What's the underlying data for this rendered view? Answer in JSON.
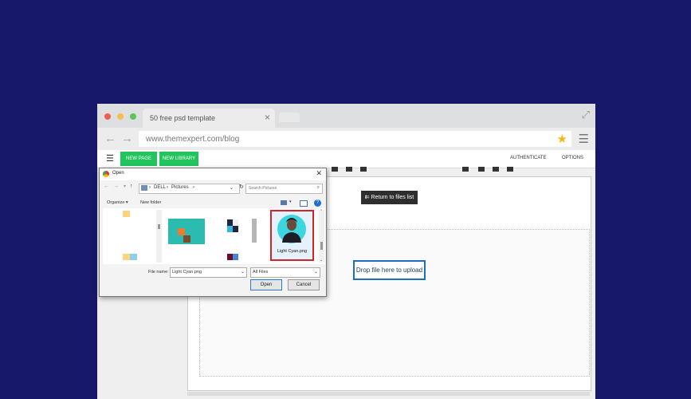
{
  "browser": {
    "tab_title": "50 free psd  template",
    "url": "www.themexpert.com/blog",
    "colors": {
      "red_dot": "#ee5c54",
      "yellow_dot": "#f5be4f",
      "green_dot": "#5fc454",
      "star": "#f4b914"
    }
  },
  "toolbar": {
    "new_page": "NEW PAGE",
    "new_library": "NEW LIBRARY",
    "authenticate": "AUTHENTICATE",
    "options": "OPTIONS"
  },
  "editor": {
    "return_button": "⇇ Return to files list",
    "drop_text": "Drop file here to upload"
  },
  "dialog": {
    "title": "Open",
    "path_parts": [
      "DELL",
      "Pictures"
    ],
    "search_placeholder": "Search Pictures",
    "organize": "Organize ▾",
    "new_folder": "New folder",
    "selected_file_label": "Light Cyan.png",
    "file_name_label": "File name:",
    "file_name_value": "Light Cyan.png",
    "filter_value": "All Files",
    "open_button": "Open",
    "cancel_button": "Cancel"
  }
}
